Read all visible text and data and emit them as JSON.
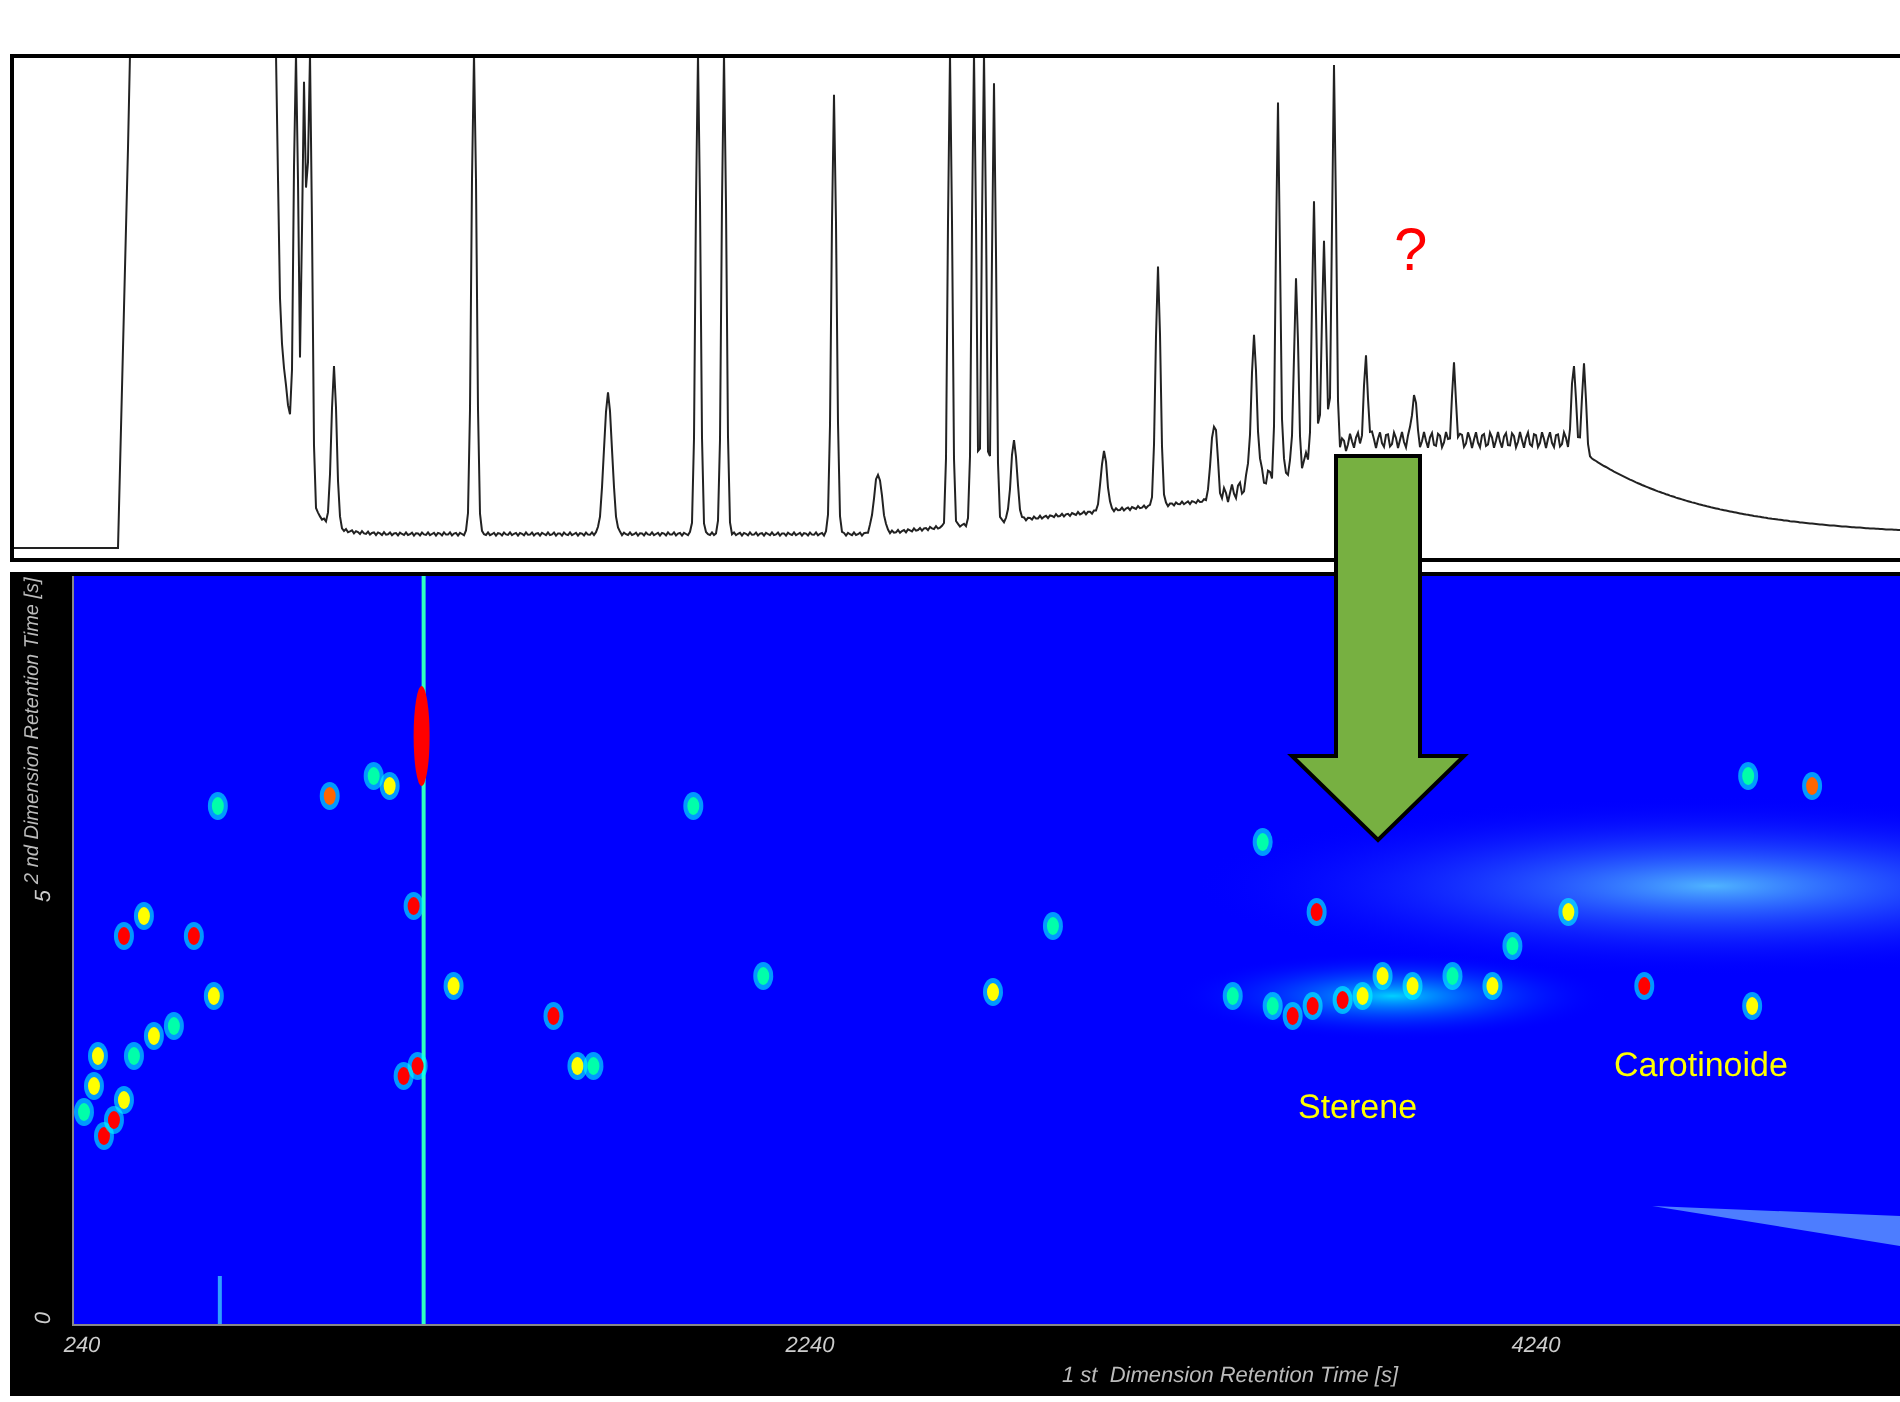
{
  "chromatogram": {
    "annotation": "?"
  },
  "heatmap": {
    "labels": [
      {
        "text": "Sterene"
      },
      {
        "text": "Carotinoide"
      }
    ],
    "y_axis": {
      "title": "2 nd Dimension Retention Time [s]",
      "ticks": [
        "0",
        "5"
      ]
    },
    "x_axis": {
      "title": "1 st  Dimension Retention Time [s]",
      "ticks": [
        "240",
        "2240",
        "4240"
      ]
    }
  }
}
